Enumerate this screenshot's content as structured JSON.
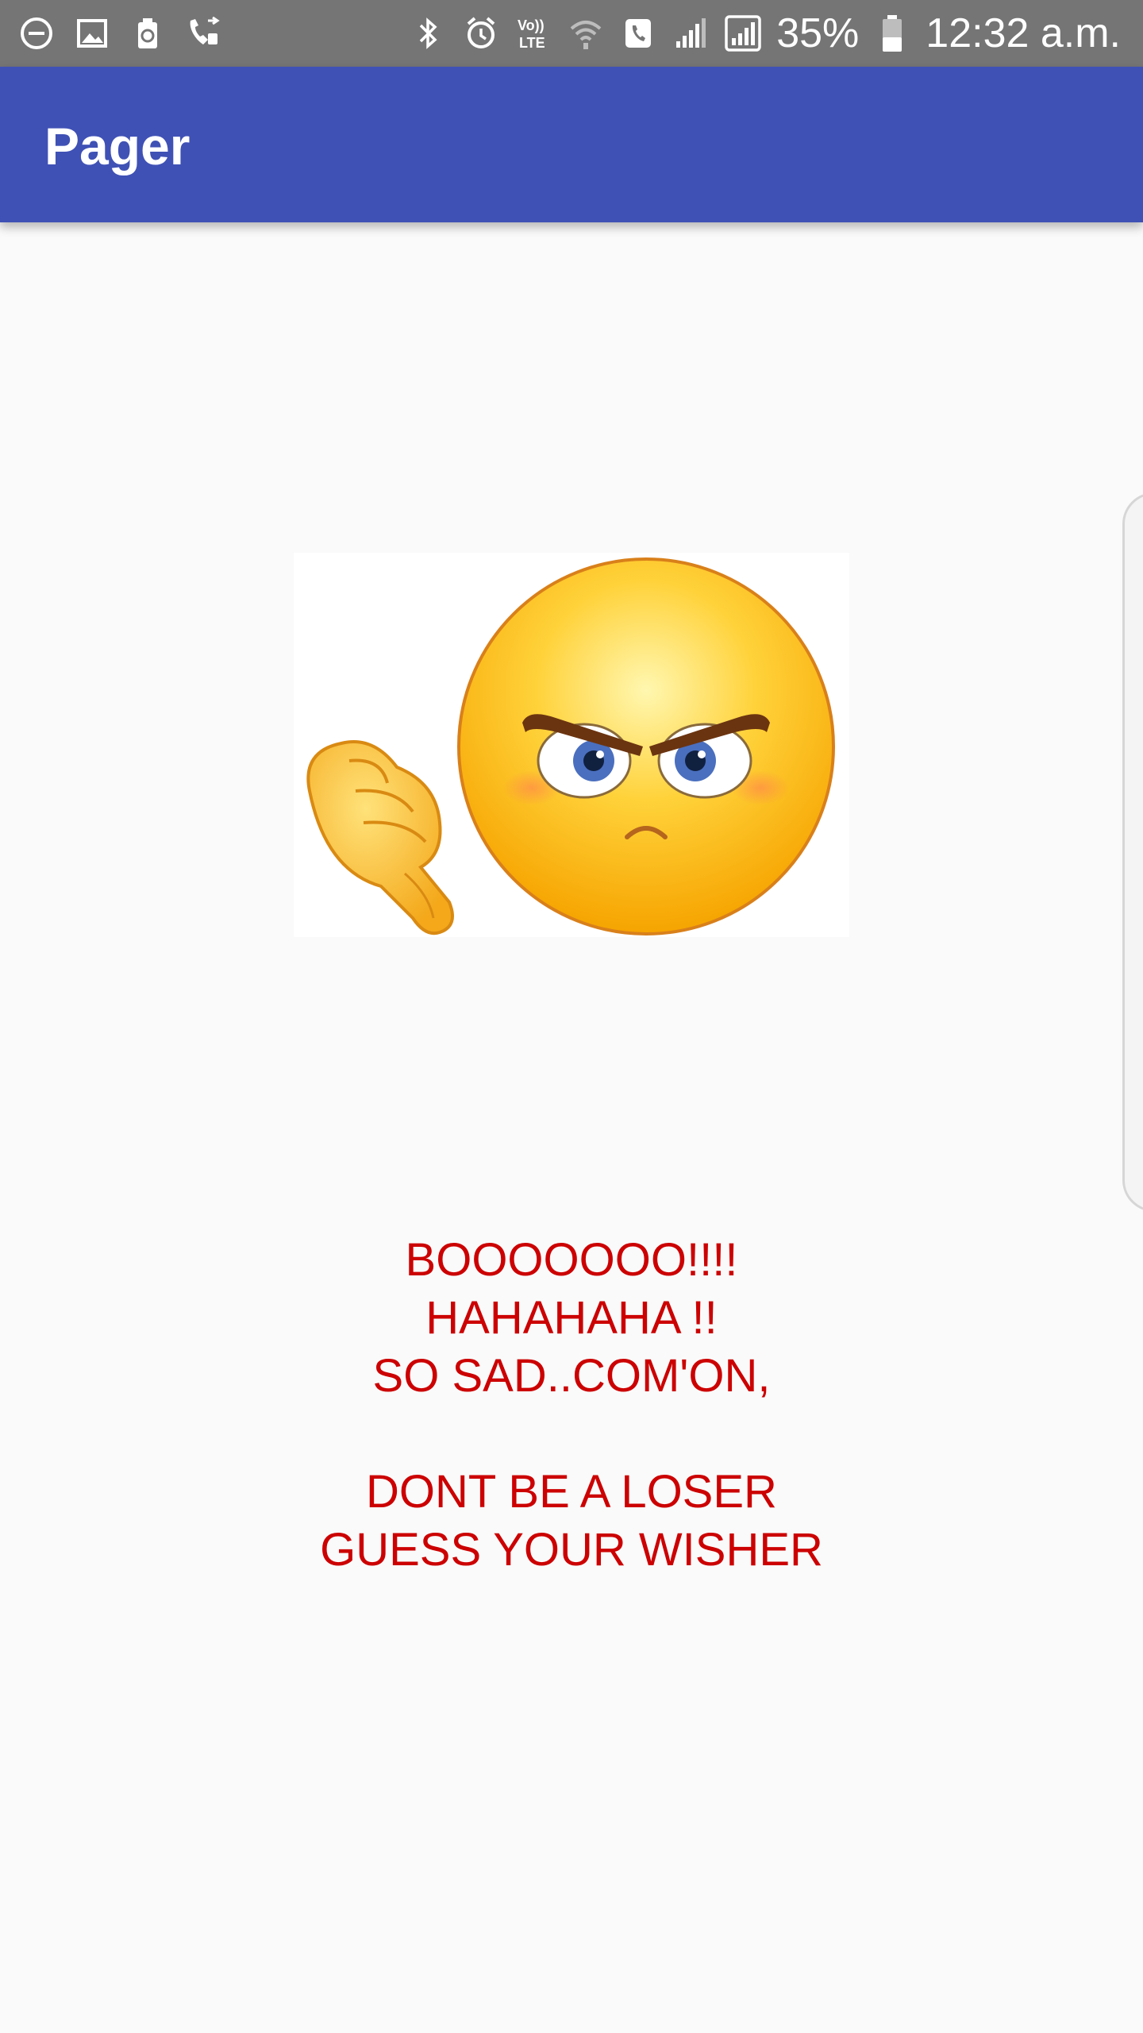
{
  "status_bar": {
    "battery_percent": "35%",
    "time": "12:32 a.m.",
    "left_icons": [
      "minus-circle-icon",
      "image-icon",
      "battery-saver-icon",
      "call-forward-icon"
    ],
    "right_icons": [
      "bluetooth-icon",
      "alarm-icon",
      "volte-icon",
      "wifi-icon",
      "phone-icon",
      "signal-icon",
      "signal-box-icon",
      "battery-icon"
    ]
  },
  "app_bar": {
    "title": "Pager",
    "color": "#3f51b5"
  },
  "emoji": {
    "icon": "angry-face-thumbs-down-icon"
  },
  "message": {
    "lines": [
      "BOOOOOOO!!!!",
      "HAHAHAHA !!",
      "SO SAD..COM'ON,",
      "",
      "DONT BE A LOSER",
      "GUESS YOUR WISHER"
    ],
    "color": "#cc0000"
  }
}
